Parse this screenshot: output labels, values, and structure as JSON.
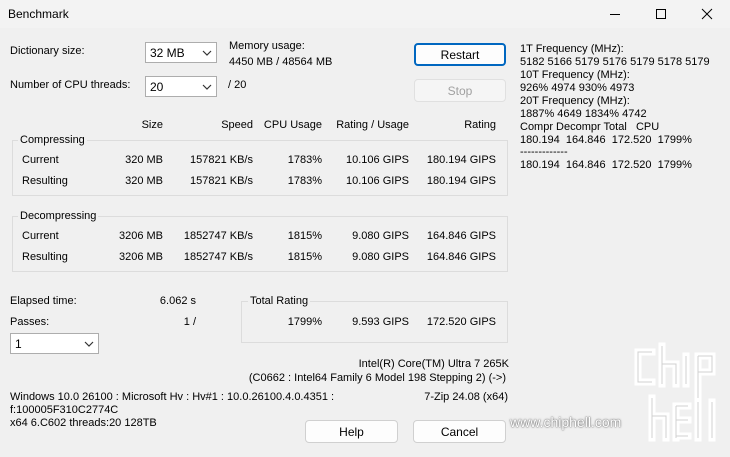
{
  "window": {
    "title": "Benchmark"
  },
  "settings": {
    "dict_label": "Dictionary size:",
    "dict_value": "32 MB",
    "threads_label": "Number of CPU threads:",
    "threads_value": "20",
    "threads_total": "/ 20",
    "memory_label": "Memory usage:",
    "memory_value": "4450 MB / 48564 MB"
  },
  "buttons": {
    "restart": "Restart",
    "stop": "Stop",
    "help": "Help",
    "cancel": "Cancel"
  },
  "columns": {
    "size": "Size",
    "speed": "Speed",
    "cpu": "CPU Usage",
    "rating_usage": "Rating / Usage",
    "rating": "Rating"
  },
  "compressing": {
    "title": "Compressing",
    "rows": [
      {
        "label": "Current",
        "size": "320 MB",
        "speed": "157821 KB/s",
        "cpu": "1783%",
        "ru": "10.106 GIPS",
        "rating": "180.194 GIPS"
      },
      {
        "label": "Resulting",
        "size": "320 MB",
        "speed": "157821 KB/s",
        "cpu": "1783%",
        "ru": "10.106 GIPS",
        "rating": "180.194 GIPS"
      }
    ]
  },
  "decompressing": {
    "title": "Decompressing",
    "rows": [
      {
        "label": "Current",
        "size": "3206 MB",
        "speed": "1852747 KB/s",
        "cpu": "1815%",
        "ru": "9.080 GIPS",
        "rating": "164.846 GIPS"
      },
      {
        "label": "Resulting",
        "size": "3206 MB",
        "speed": "1852747 KB/s",
        "cpu": "1815%",
        "ru": "9.080 GIPS",
        "rating": "164.846 GIPS"
      }
    ]
  },
  "elapsed": {
    "label": "Elapsed time:",
    "value": "6.062 s"
  },
  "passes": {
    "label": "Passes:",
    "value": "1 /",
    "combo": "1"
  },
  "total": {
    "title": "Total Rating",
    "cpu": "1799%",
    "ru": "9.593 GIPS",
    "rating": "172.520 GIPS"
  },
  "cpuinfo": {
    "name": "Intel(R) Core(TM) Ultra 7 265K",
    "detail": "(C0662 : Intel64 Family 6 Model 198 Stepping 2) (->)",
    "version": "7-Zip 24.08 (x64)"
  },
  "sysinfo": {
    "line1": "Windows 10.0 26100 : Microsoft Hv : Hv#1 : 10.0.26100.4.0.4351 :",
    "line2": "f:100005F310C2774C",
    "line3": "x64 6.C602 threads:20 128TB"
  },
  "freq": {
    "l1": "1T Frequency (MHz):",
    "l2": " 5182 5166 5179 5176 5179 5178 5179",
    "l3": "10T Frequency (MHz):",
    "l4": " 926% 4974 930% 4973",
    "l5": "20T Frequency (MHz):",
    "l6": " 1887% 4649 1834% 4742",
    "l7": "Compr Decompr Total   CPU",
    "l8": "180.194  164.846  172.520  1799%",
    "l9": "-------------",
    "l10": "180.194  164.846  172.520  1799%"
  },
  "watermark": {
    "text": "www.chiphell.com"
  }
}
